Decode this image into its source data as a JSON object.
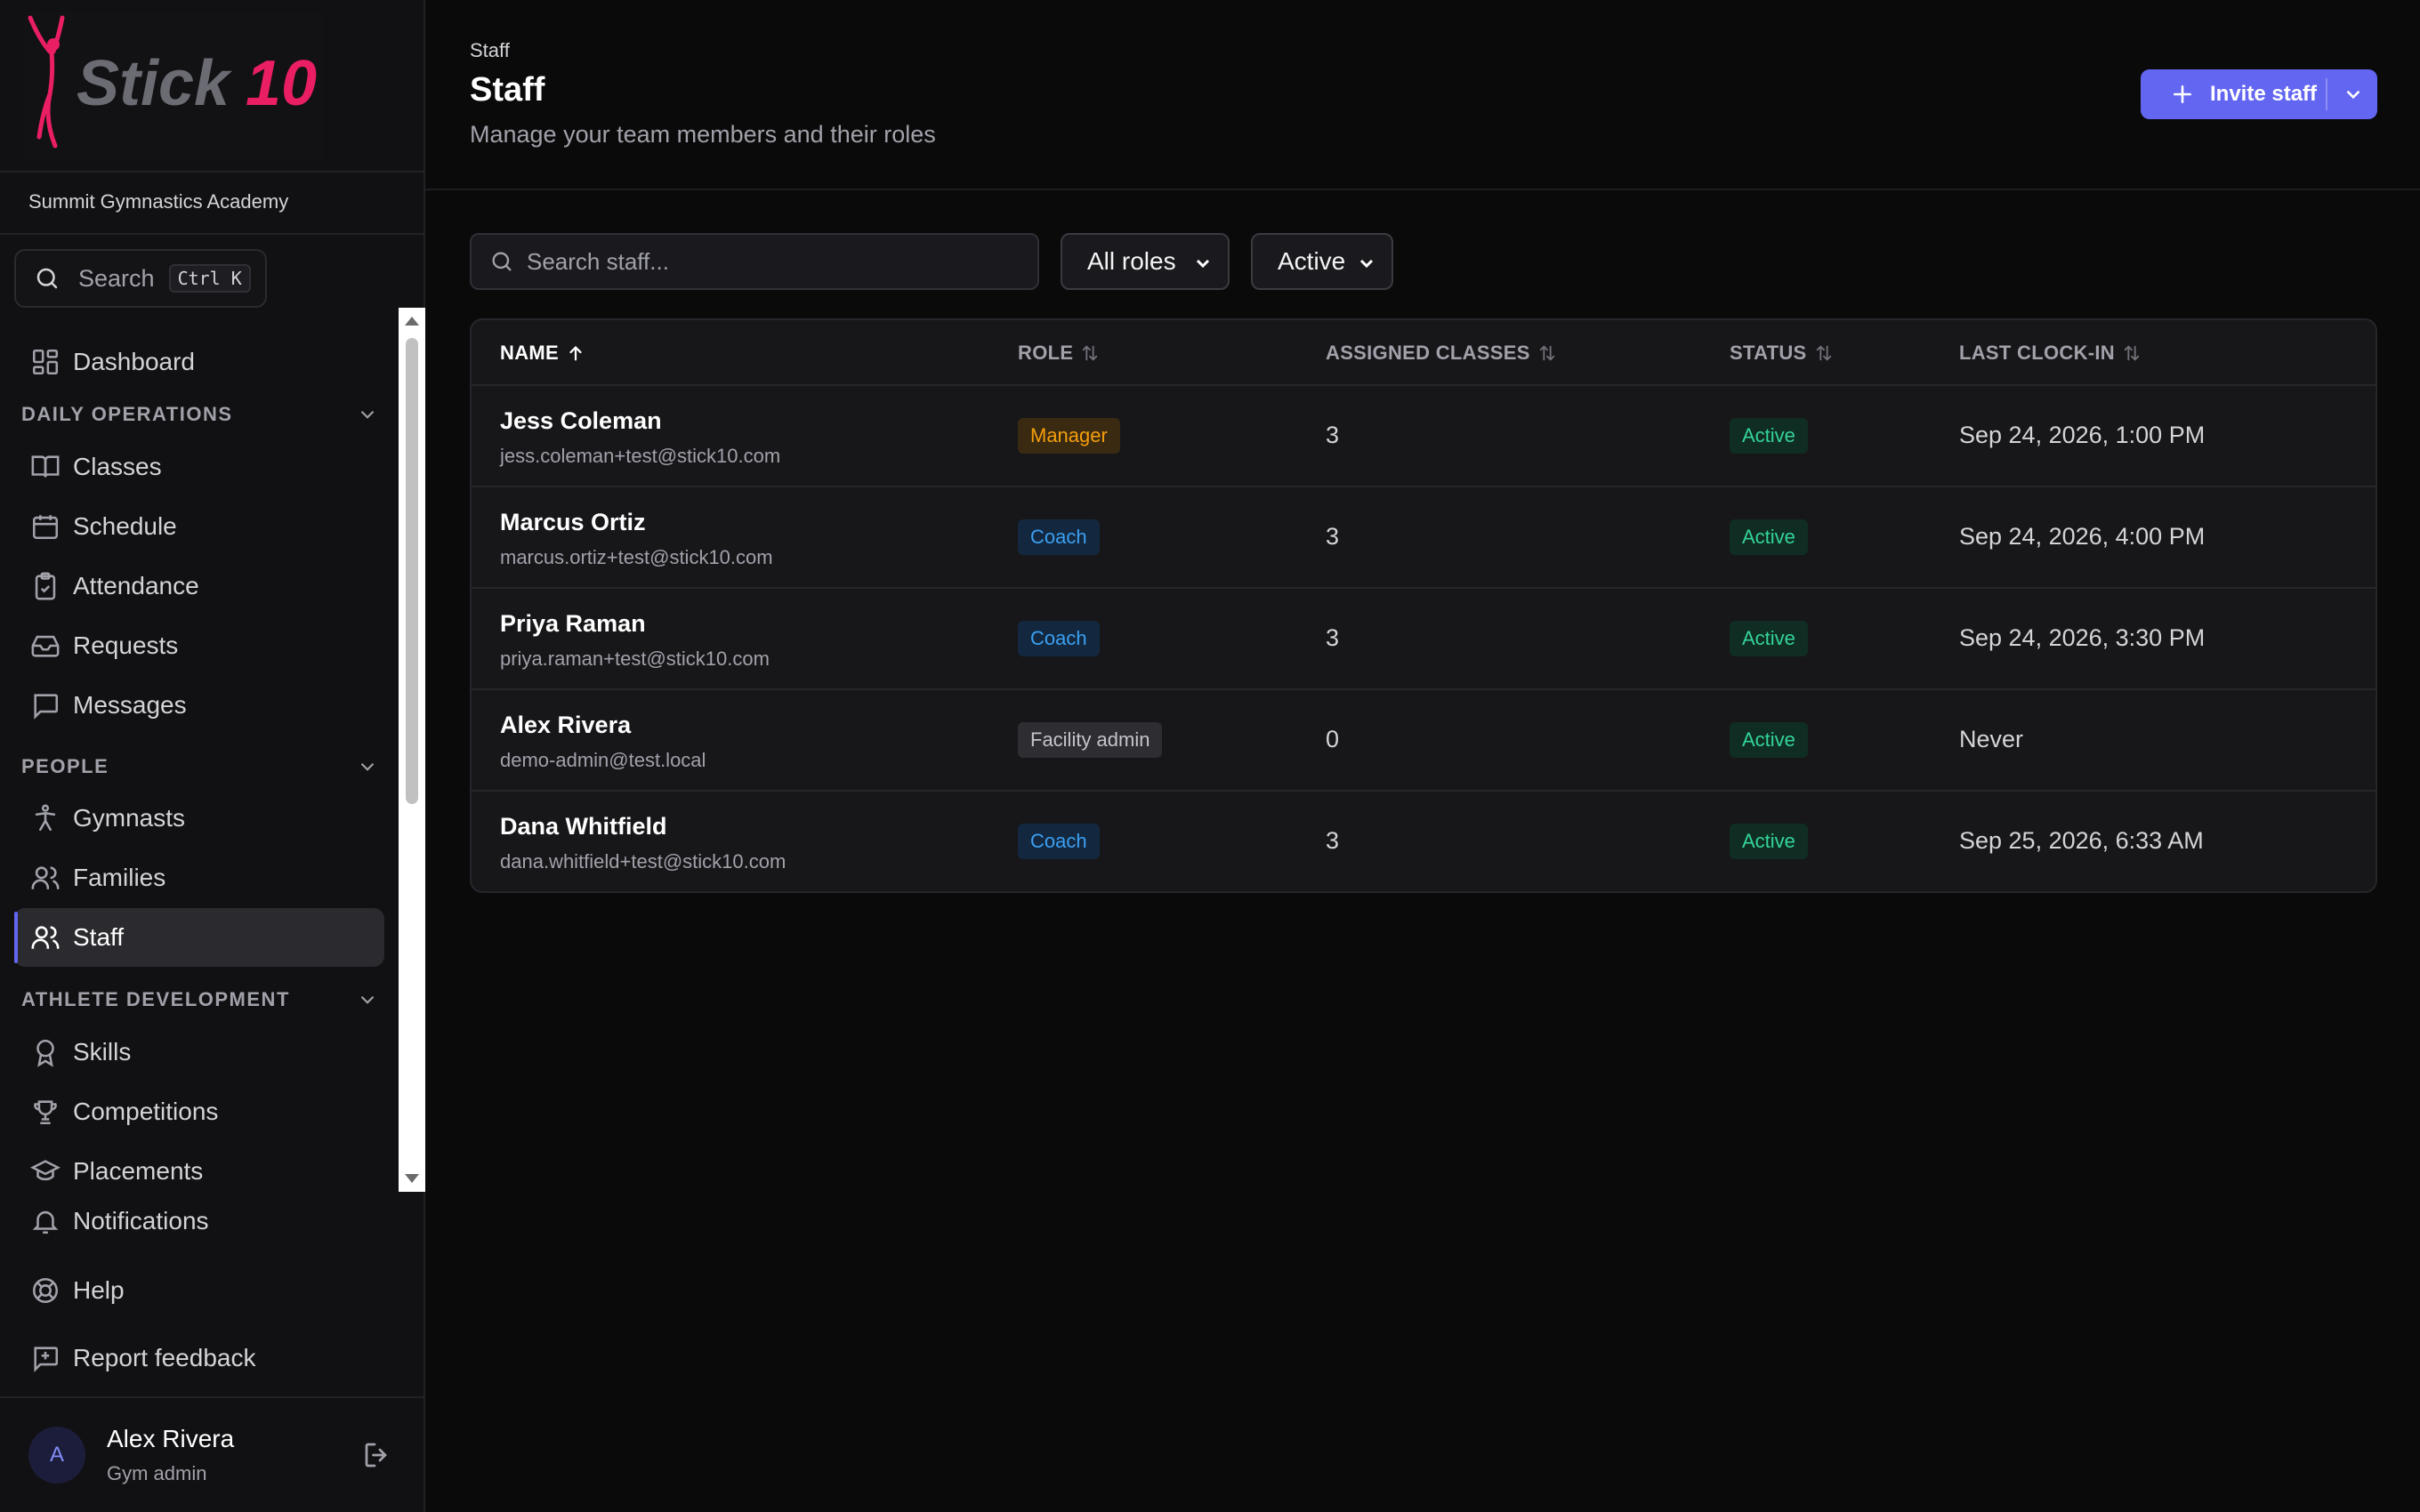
{
  "app": {
    "brand": "Stick10",
    "organization": "Summit Gymnastics Academy",
    "accent_color": "#6366f1",
    "brand_color": "#e91e63"
  },
  "sidebar": {
    "search": {
      "label": "Search",
      "shortcut": "Ctrl K",
      "icon": "search-icon"
    },
    "dashboard": {
      "label": "Dashboard",
      "icon": "dashboard-icon"
    },
    "sections": [
      {
        "title": "DAILY OPERATIONS",
        "items": [
          {
            "label": "Classes",
            "icon": "book-icon"
          },
          {
            "label": "Schedule",
            "icon": "calendar-icon"
          },
          {
            "label": "Attendance",
            "icon": "clipboard-check-icon"
          },
          {
            "label": "Requests",
            "icon": "inbox-icon"
          },
          {
            "label": "Messages",
            "icon": "message-icon"
          }
        ]
      },
      {
        "title": "PEOPLE",
        "items": [
          {
            "label": "Gymnasts",
            "icon": "person-running-icon"
          },
          {
            "label": "Families",
            "icon": "users-icon"
          },
          {
            "label": "Staff",
            "icon": "users-icon",
            "active": true
          }
        ]
      },
      {
        "title": "ATHLETE DEVELOPMENT",
        "items": [
          {
            "label": "Skills",
            "icon": "award-icon"
          },
          {
            "label": "Competitions",
            "icon": "trophy-icon"
          },
          {
            "label": "Placements",
            "icon": "graduation-cap-icon"
          }
        ]
      }
    ],
    "bottom": [
      {
        "label": "Notifications",
        "icon": "bell-icon"
      },
      {
        "label": "Help",
        "icon": "lifebuoy-icon"
      },
      {
        "label": "Report feedback",
        "icon": "message-plus-icon"
      }
    ],
    "user": {
      "initial": "A",
      "name": "Alex Rivera",
      "role": "Gym admin"
    }
  },
  "header": {
    "breadcrumb": "Staff",
    "title": "Staff",
    "subtitle": "Manage your team members and their roles",
    "invite_label": "Invite staff"
  },
  "filters": {
    "search_placeholder": "Search staff...",
    "role_selected": "All roles",
    "status_selected": "Active"
  },
  "table": {
    "columns": [
      "NAME",
      "ROLE",
      "ASSIGNED CLASSES",
      "STATUS",
      "LAST CLOCK-IN"
    ],
    "sorted_by": "NAME",
    "rows": [
      {
        "name": "Jess Coleman",
        "email": "jess.coleman+test@stick10.com",
        "role": "Manager",
        "role_kind": "manager",
        "classes": "3",
        "status": "Active",
        "last_clock_in": "Sep 24, 2026, 1:00 PM"
      },
      {
        "name": "Marcus Ortiz",
        "email": "marcus.ortiz+test@stick10.com",
        "role": "Coach",
        "role_kind": "coach",
        "classes": "3",
        "status": "Active",
        "last_clock_in": "Sep 24, 2026, 4:00 PM"
      },
      {
        "name": "Priya Raman",
        "email": "priya.raman+test@stick10.com",
        "role": "Coach",
        "role_kind": "coach",
        "classes": "3",
        "status": "Active",
        "last_clock_in": "Sep 24, 2026, 3:30 PM"
      },
      {
        "name": "Alex Rivera",
        "email": "demo-admin@test.local",
        "role": "Facility admin",
        "role_kind": "facility",
        "classes": "0",
        "status": "Active",
        "last_clock_in": "Never"
      },
      {
        "name": "Dana Whitfield",
        "email": "dana.whitfield+test@stick10.com",
        "role": "Coach",
        "role_kind": "coach",
        "classes": "3",
        "status": "Active",
        "last_clock_in": "Sep 25, 2026, 6:33 AM"
      }
    ]
  }
}
